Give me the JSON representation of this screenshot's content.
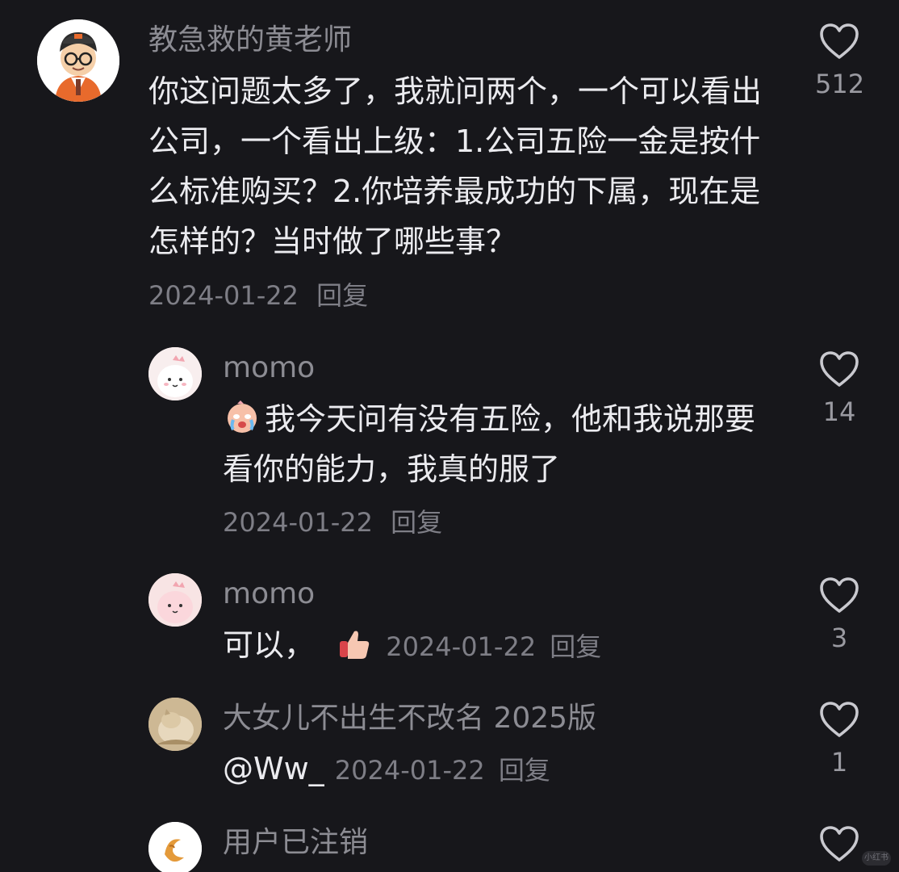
{
  "comments": [
    {
      "username": "教急救的黄老师",
      "text": "你这问题太多了，我就问两个，一个可以看出公司，一个看出上级：1.公司五险一金是按什么标准购买？2.你培养最成功的下属，现在是怎样的？当时做了哪些事？",
      "date": "2024-01-22",
      "reply_label": "回复",
      "likes": "512",
      "avatar_icon": "teacher-avatar"
    },
    {
      "username": "momo",
      "text": "我今天问有没有五险，他和我说那要看你的能力，我真的服了",
      "emoji_icon": "crying-face-emoji",
      "date": "2024-01-22",
      "reply_label": "回复",
      "likes": "14",
      "avatar_icon": "pink-cartoon-avatar"
    },
    {
      "username": "momo",
      "text": "可以，",
      "emoji_icon": "thumbs-up-emoji",
      "date": "2024-01-22",
      "reply_label": "回复",
      "likes": "3",
      "avatar_icon": "pink-cartoon-avatar"
    },
    {
      "username": "大女儿不出生不改名 2025版",
      "text": "@Ww_",
      "date": "2024-01-22",
      "reply_label": "回复",
      "likes": "1",
      "avatar_icon": "cat-photo-avatar"
    },
    {
      "username": "用户已注销",
      "avatar_icon": "croissant-avatar"
    }
  ],
  "watermark": "小红书",
  "colors": {
    "background": "#17171b",
    "username": "#8c8c93",
    "body_text": "#ebebef",
    "meta": "#7e7e86",
    "heart": "#c9c9cf"
  }
}
